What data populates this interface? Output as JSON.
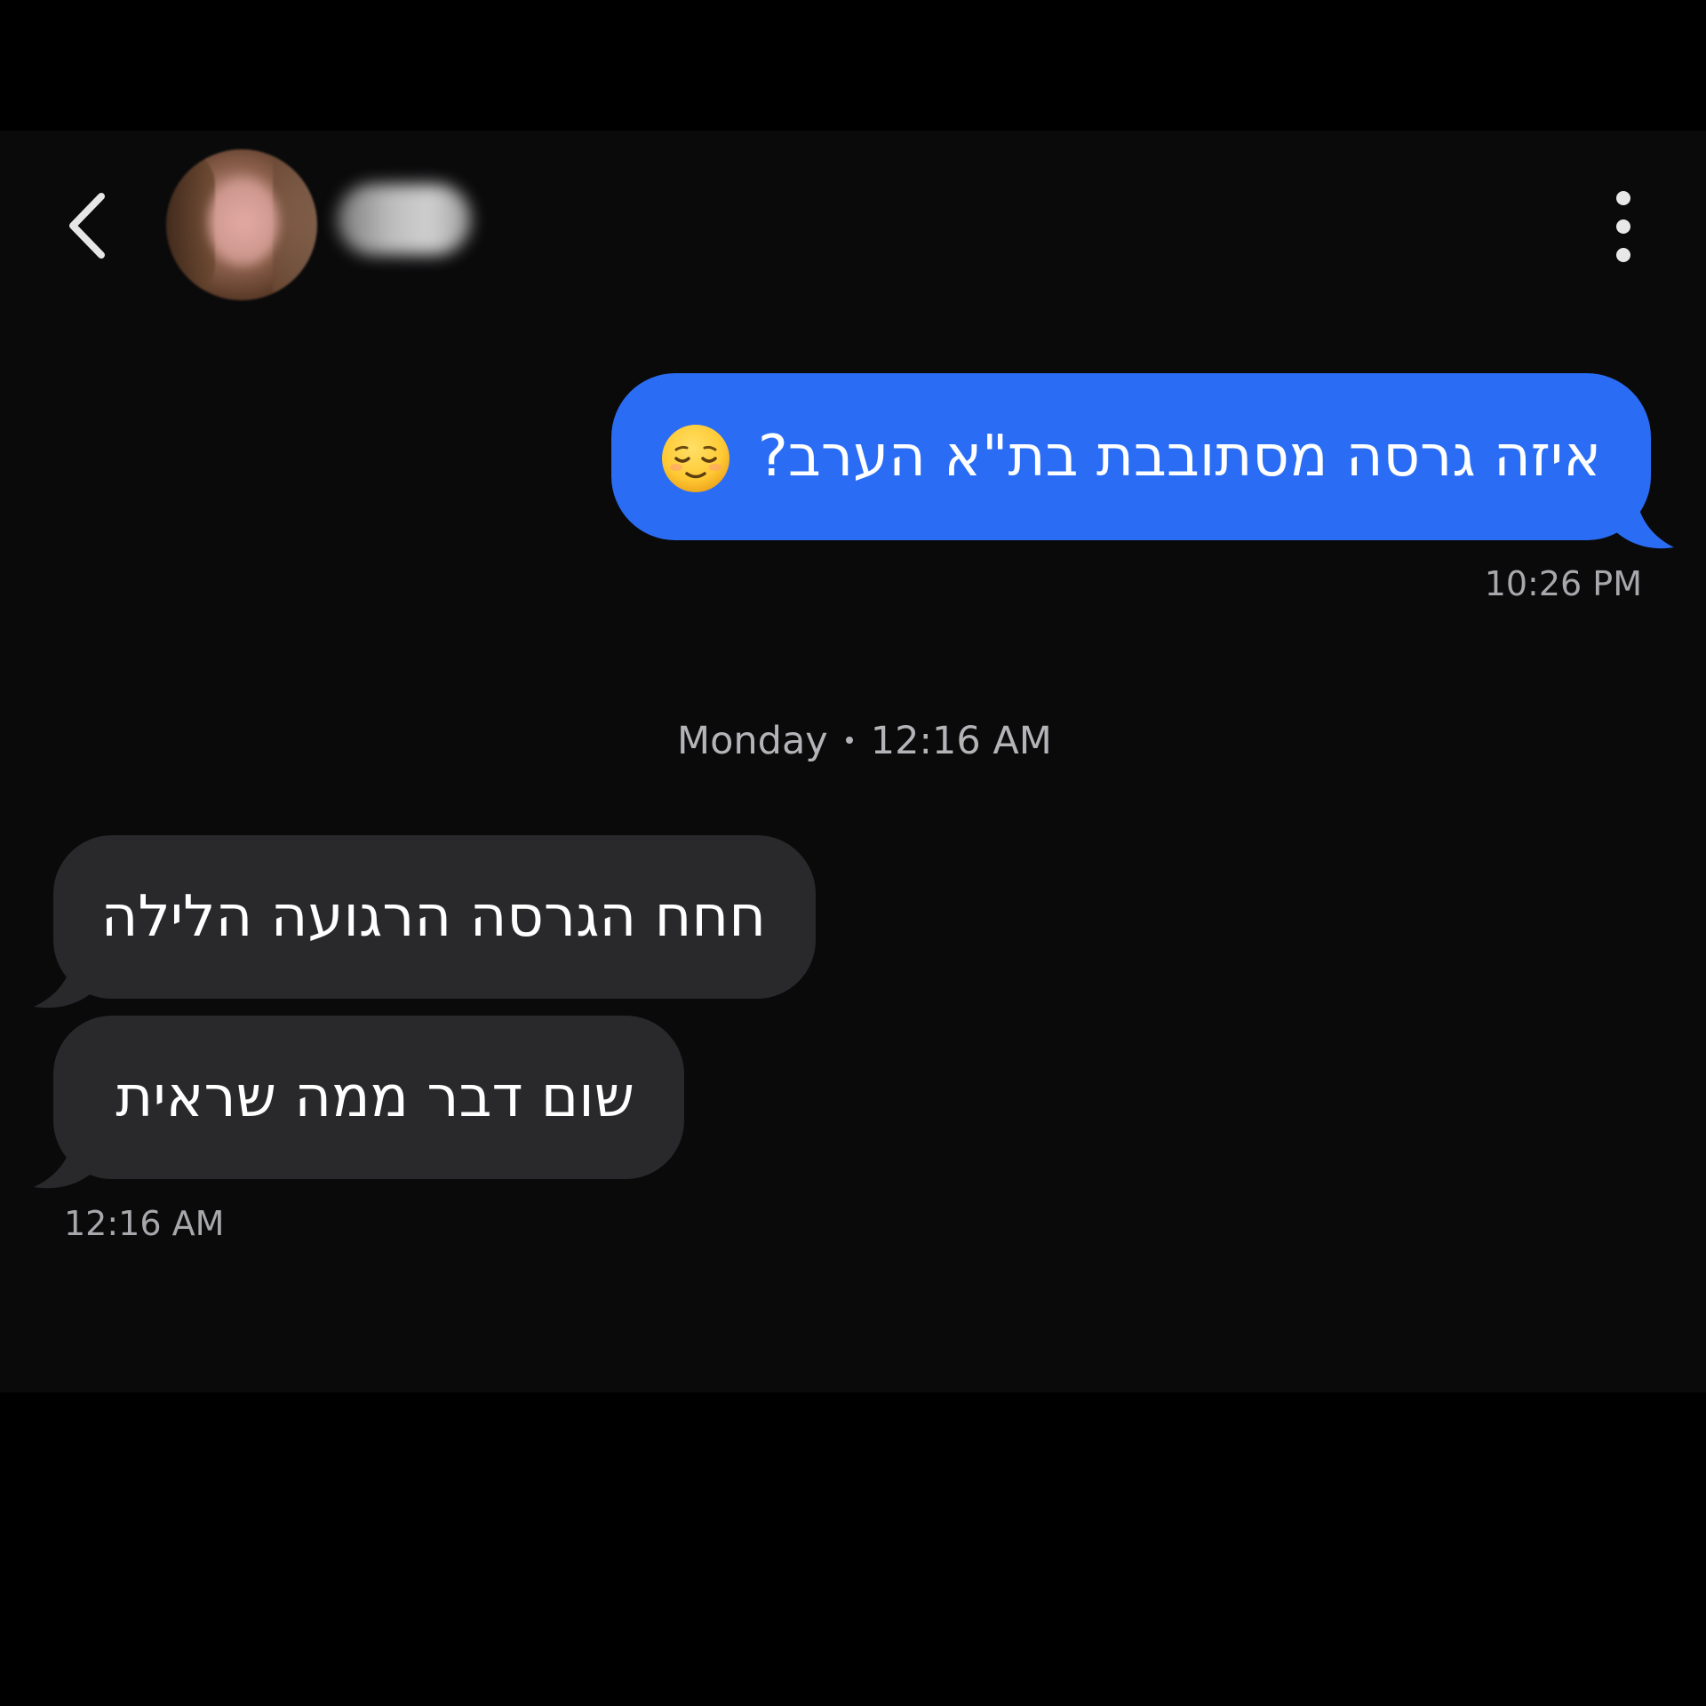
{
  "header": {
    "back_icon": "chevron-left-icon",
    "more_icon": "vertical-ellipsis-icon"
  },
  "messages": [
    {
      "direction": "outgoing",
      "text": "איזה גרסה מסתובבת בת\"א הערב?",
      "emoji": "relieved-face-emoji",
      "time": "10:26 PM"
    },
    {
      "direction": "incoming",
      "text": "חחח הגרסה הרגועה הלילה"
    },
    {
      "direction": "incoming",
      "text": "שום דבר ממה שראית",
      "time": "12:16 AM"
    }
  ],
  "day_separator": {
    "day": "Monday",
    "time": "12:16 AM"
  },
  "colors": {
    "background": "#0a0a0b",
    "outgoing_bubble": "#2a6df4",
    "incoming_bubble": "#29292c",
    "timestamp": "#a8a8ac"
  }
}
